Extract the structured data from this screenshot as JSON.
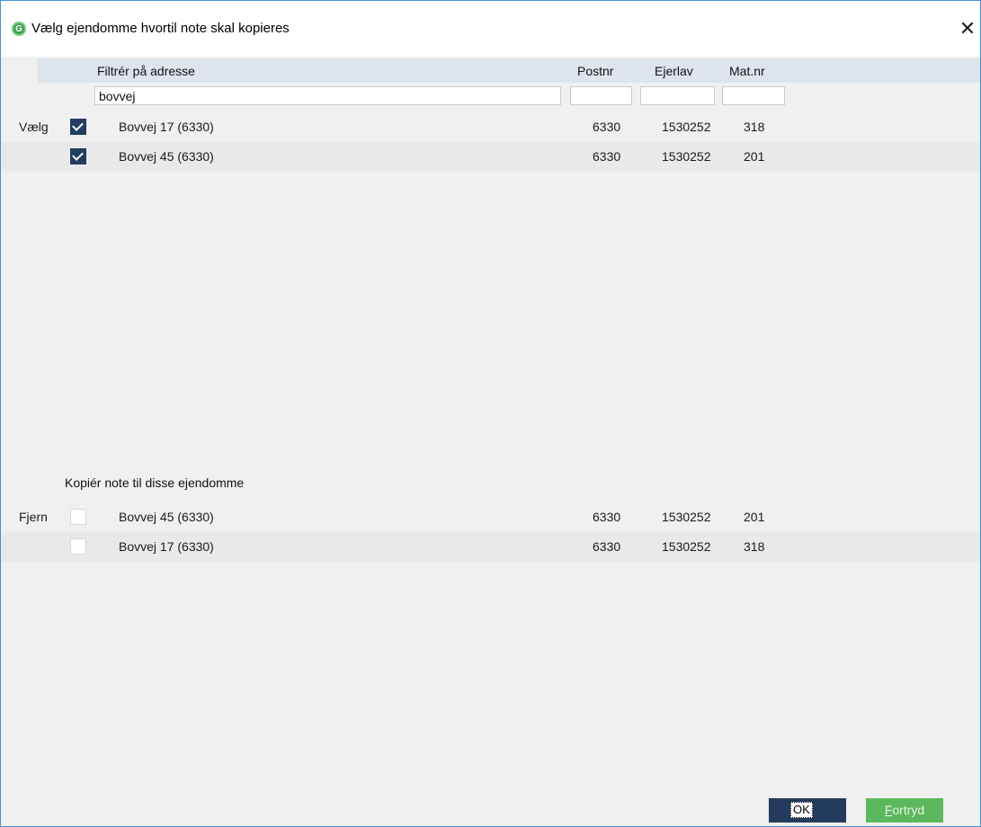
{
  "window": {
    "title": "Vælg ejendomme hvortil note skal kopieres",
    "icon_letter": "G",
    "close_glyph": "✕"
  },
  "columns": {
    "address": "Filtrér på adresse",
    "postnr": "Postnr",
    "ejerlav": "Ejerlav",
    "matnr": "Mat.nr"
  },
  "filters": {
    "address": "bovvej",
    "postnr": "",
    "ejerlav": "",
    "matnr": ""
  },
  "available": {
    "row_label": "Vælg",
    "rows": [
      {
        "address": "Bovvej 17 (6330)",
        "postnr": "6330",
        "ejerlav": "1530252",
        "matnr": "318",
        "checked": true
      },
      {
        "address": "Bovvej 45 (6330)",
        "postnr": "6330",
        "ejerlav": "1530252",
        "matnr": "201",
        "checked": true
      }
    ]
  },
  "selected": {
    "section_title": "Kopiér note til disse ejendomme",
    "row_label": "Fjern",
    "rows": [
      {
        "address": "Bovvej 45 (6330)",
        "postnr": "6330",
        "ejerlav": "1530252",
        "matnr": "201",
        "checked": false
      },
      {
        "address": "Bovvej 17 (6330)",
        "postnr": "6330",
        "ejerlav": "1530252",
        "matnr": "318",
        "checked": false
      }
    ]
  },
  "buttons": {
    "ok": "OK",
    "cancel_mnemonic": "F",
    "cancel_rest": "ortryd"
  },
  "colors": {
    "checkbox_checked": "#223d5f",
    "ok_button": "#233b5c",
    "cancel_button": "#5cb85c",
    "app_icon": "#3aa34a"
  }
}
